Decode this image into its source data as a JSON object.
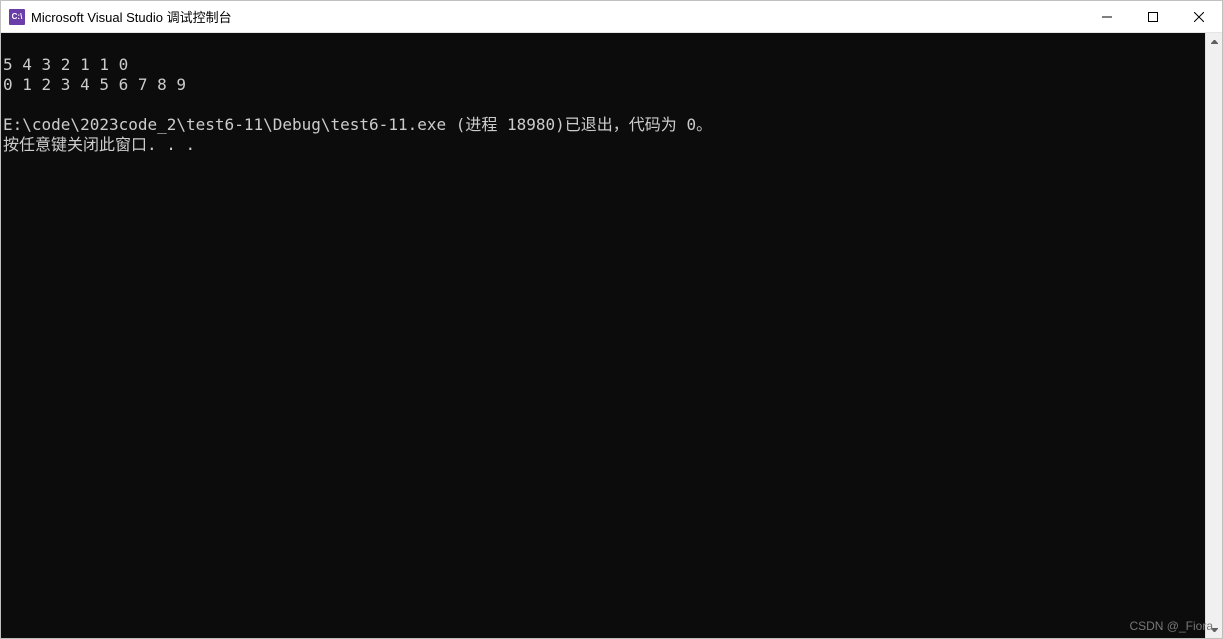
{
  "window": {
    "icon_text": "C:\\",
    "title": "Microsoft Visual Studio 调试控制台"
  },
  "console": {
    "lines": [
      "5 4 3 2 1 1 0",
      "0 1 2 3 4 5 6 7 8 9",
      "",
      "E:\\code\\2023code_2\\test6-11\\Debug\\test6-11.exe (进程 18980)已退出，代码为 0。",
      "按任意键关闭此窗口. . ."
    ]
  },
  "watermark": "CSDN @_Fiora"
}
